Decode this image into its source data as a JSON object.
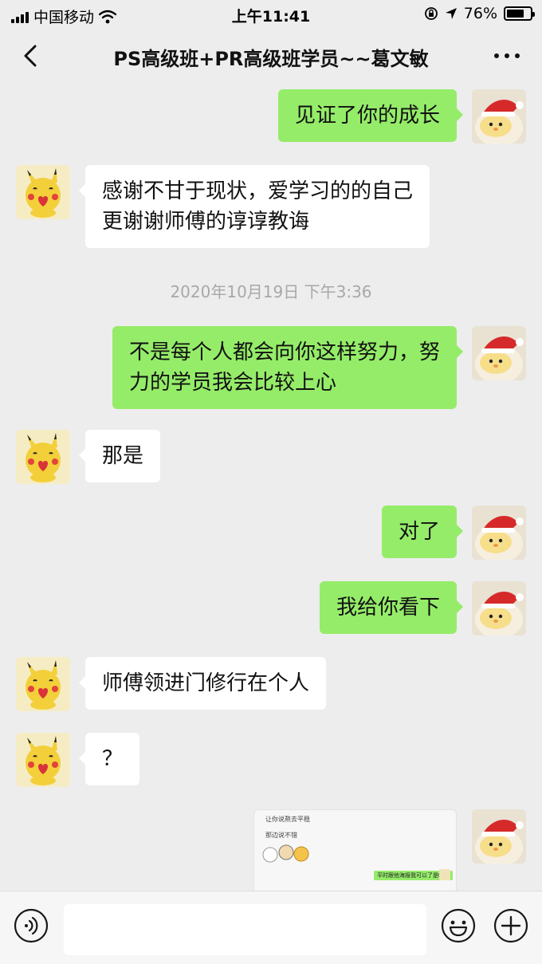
{
  "status_bar": {
    "carrier": "中国移动",
    "time": "上午11:41",
    "battery": "76%",
    "battery_level": 0.76
  },
  "nav": {
    "title": "PS高级班+PR高级班学员~~葛文敏"
  },
  "messages": [
    {
      "side": "out",
      "lines": [
        "见证了你的成长"
      ]
    },
    {
      "side": "in",
      "lines": [
        "感谢不甘于现状，爱学习的的自己",
        "更谢谢师傅的谆谆教诲"
      ]
    },
    {
      "side": "out",
      "lines": [
        "不是每个人都会向你这样努力，努",
        "力的学员我会比较上心"
      ]
    },
    {
      "side": "in",
      "lines": [
        "那是"
      ]
    },
    {
      "side": "out",
      "lines": [
        "对了"
      ]
    },
    {
      "side": "out",
      "lines": [
        "我给你看下"
      ]
    },
    {
      "side": "in",
      "lines": [
        "师傅领进门修行在个人"
      ]
    },
    {
      "side": "in",
      "lines": [
        "？"
      ]
    }
  ],
  "timestamp": "2020年10月19日 下午3:36",
  "shared_image": {
    "line1": "让你说熬去平稳",
    "line2": "那边说不错",
    "line3": "平时跟他海报我可以了是吧？"
  },
  "icons": {
    "back": "chevron-left-icon",
    "more": "more-dots-icon",
    "voice": "voice-icon",
    "emoji": "emoji-icon",
    "plus": "plus-icon",
    "wifi": "wifi-icon",
    "location": "location-icon",
    "lock": "rotation-lock-icon"
  },
  "colors": {
    "background": "#ededed",
    "outgoing_bubble": "#95ec69",
    "incoming_bubble": "#ffffff",
    "timestamp_text": "#a8a8a8"
  }
}
